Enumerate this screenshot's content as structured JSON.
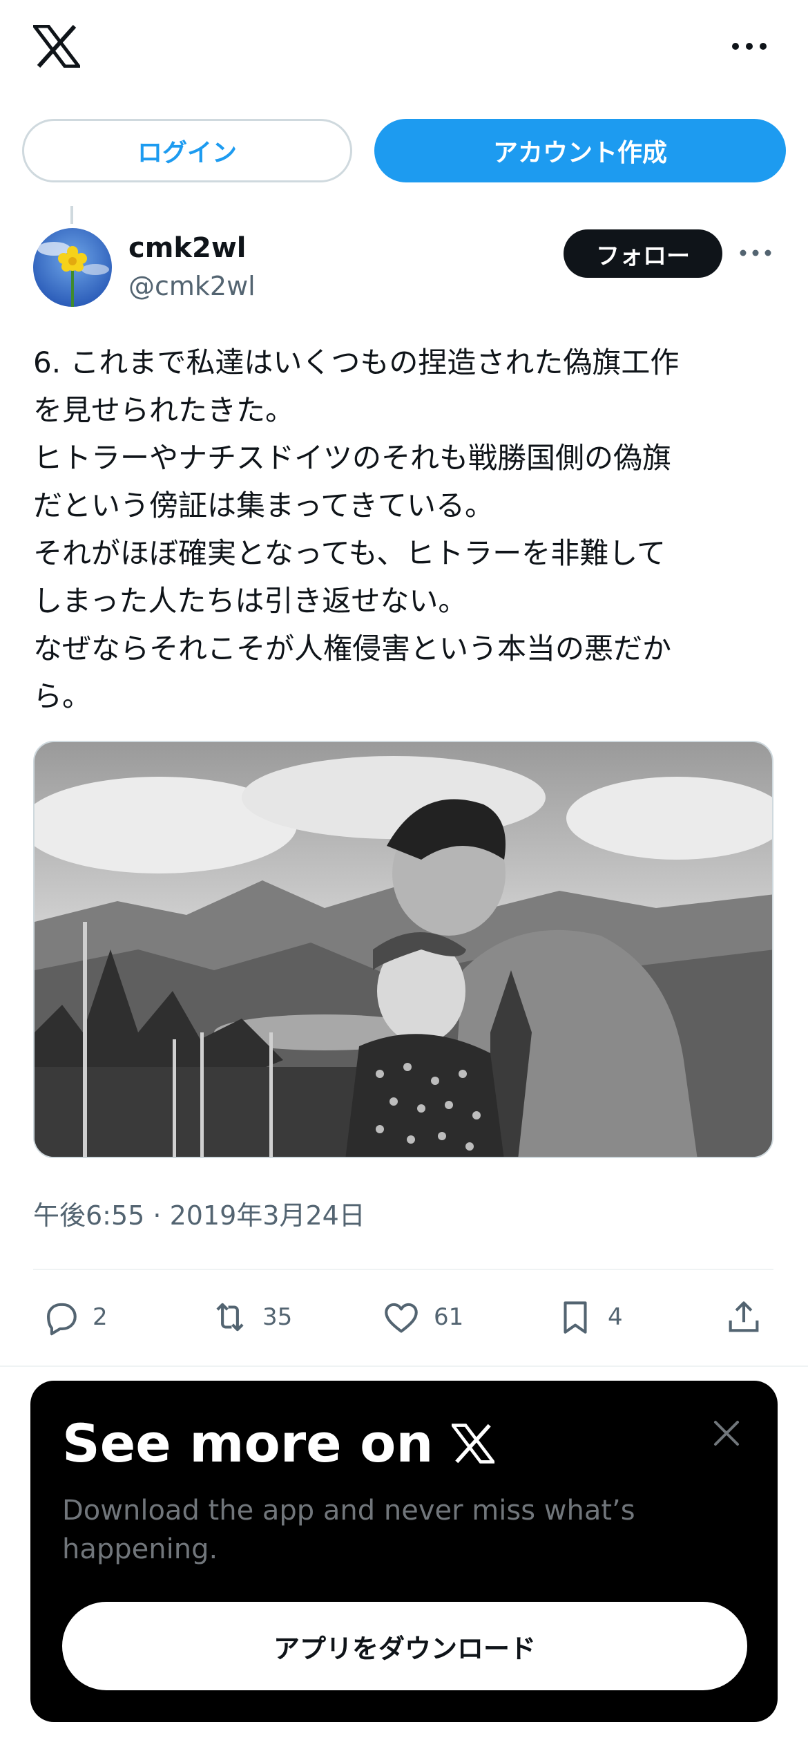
{
  "header": {
    "logo_icon": "x-logo-icon",
    "more_icon": "more-icon"
  },
  "auth": {
    "login_label": "ログイン",
    "signup_label": "アカウント作成"
  },
  "tweet": {
    "author_name": "cmk2wl",
    "author_handle": "@cmk2wl",
    "follow_label": "フォロー",
    "text": "6. これまで私達はいくつもの捏造された偽旗工作\nを見せられたきた。\nヒトラーやナチスドイツのそれも戦勝国側の偽旗\nだという傍証は集まってきている。\nそれがほぼ確実となっても、ヒトラーを非難して\nしまった人たちは引き返せない。\nなぜならそれこそが人権侵害という本当の悪だか\nら。",
    "timestamp": "午後6:55 · 2019年3月24日",
    "counts": {
      "replies": "2",
      "retweets": "35",
      "likes": "61",
      "bookmarks": "4"
    }
  },
  "promo": {
    "title": "See more on",
    "subtitle": "Download the app and never miss what’s happening.",
    "download_label": "アプリをダウンロード"
  },
  "colors": {
    "accent": "#1d9bf0",
    "text": "#0f1419",
    "muted": "#536471",
    "border": "#cfd9de"
  }
}
